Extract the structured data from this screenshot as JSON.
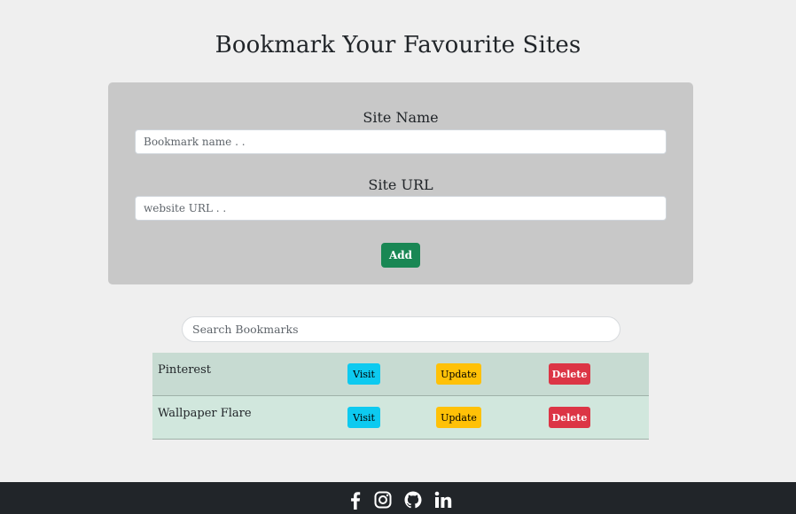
{
  "page": {
    "title": "Bookmark Your Favourite Sites"
  },
  "form": {
    "site_name_label": "Site Name",
    "site_name_placeholder": "Bookmark name . .",
    "site_name_value": "",
    "site_url_label": "Site URL",
    "site_url_placeholder": "website URL . .",
    "site_url_value": "",
    "add_label": "Add"
  },
  "search": {
    "placeholder": "Search Bookmarks",
    "value": ""
  },
  "bookmarks": [
    {
      "name": "Pinterest",
      "visit_label": "Visit",
      "update_label": "Update",
      "delete_label": "Delete"
    },
    {
      "name": "Wallpaper Flare",
      "visit_label": "Visit",
      "update_label": "Update",
      "delete_label": "Delete"
    }
  ],
  "footer": {
    "icons": [
      "facebook-icon",
      "instagram-icon",
      "github-icon",
      "linkedin-icon"
    ]
  },
  "colors": {
    "background": "#efefef",
    "form_panel": "#c8c8c8",
    "add_button": "#198754",
    "visit_button": "#0dcaf0",
    "update_button": "#ffc107",
    "delete_button": "#dc3545",
    "row_background": "#d1e7dd",
    "footer": "#212529"
  }
}
